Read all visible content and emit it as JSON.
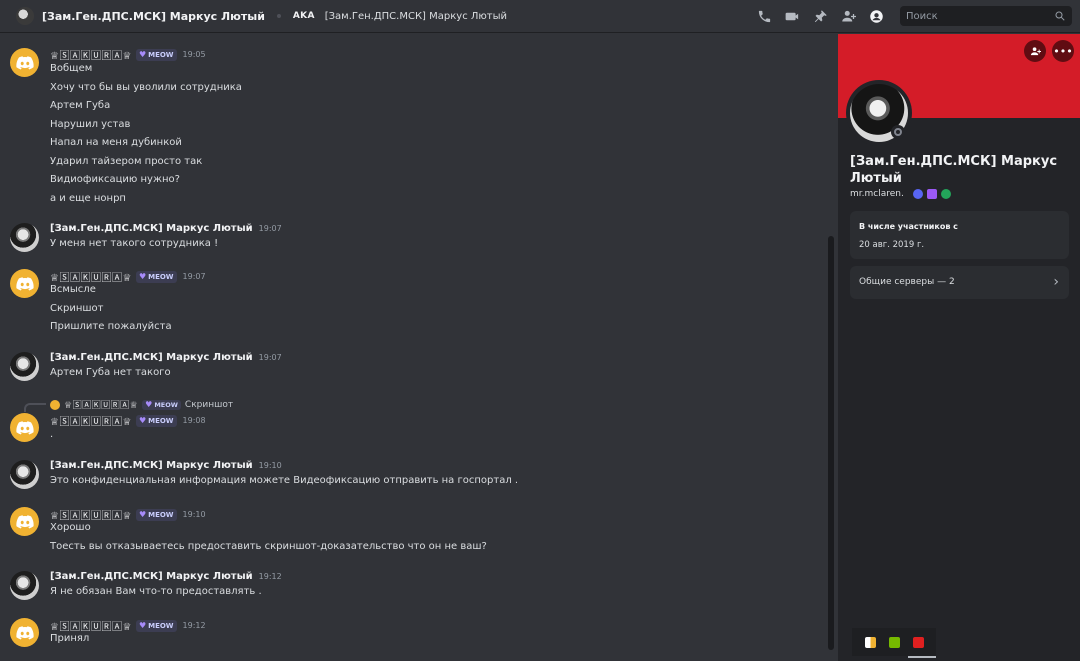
{
  "header": {
    "title": "[Зам.Ген.ДПС.МСК] Маркус Лютый",
    "aka_label": "AKA",
    "aka_name": "[Зам.Ген.ДПС.МСК] Маркус Лютый",
    "icons": [
      "phone-call-icon",
      "video-call-icon",
      "pin-icon",
      "add-friend-icon",
      "user-profile-icon"
    ],
    "search_placeholder": "Поиск"
  },
  "users": {
    "sakura_name": "♕🅂🄰🄺🅄🅁🄰♕",
    "sakura_tag": "MEOW",
    "marcus_name": "[Зам.Ген.ДПС.МСК] Маркус Лютый"
  },
  "messages": [
    {
      "author": "sakura",
      "time": "19:05",
      "lines": [
        "Вобщем",
        "Хочу что бы вы уволили сотрудника",
        "Артем Губа",
        "Нарушил устав",
        "Напал на меня дубинкой",
        "Ударил тайзером просто так",
        "Видиофиксацию нужно?",
        "а и еще нонрп"
      ]
    },
    {
      "author": "marcus",
      "time": "19:07",
      "lines": [
        "У меня нет такого сотрудника !"
      ]
    },
    {
      "author": "sakura",
      "time": "19:07",
      "lines": [
        "Всмысле",
        "Скриншот",
        "Пришлите пожалуйста"
      ]
    },
    {
      "author": "marcus",
      "time": "19:07",
      "lines": [
        "Артем Губа нет такого"
      ]
    },
    {
      "author": "sakura",
      "time": "19:08",
      "reply_text": "Скриншот",
      "lines": [
        "."
      ]
    },
    {
      "author": "marcus",
      "time": "19:10",
      "lines": [
        "Это конфиденциальная информация можете Видеофиксацию отправить на госпортал ."
      ]
    },
    {
      "author": "sakura",
      "time": "19:10",
      "lines": [
        "Хорошо",
        "Тоесть вы отказываетесь предоставить скриншот-доказательство что он не ваш?"
      ]
    },
    {
      "author": "marcus",
      "time": "19:12",
      "lines": [
        "Я не обязан Вам что-то предоставлять ."
      ]
    },
    {
      "author": "sakura",
      "time": "19:12",
      "lines": [
        "Принял"
      ]
    }
  ],
  "profile": {
    "banner_color": "#d41c28",
    "name": "[Зам.Ген.ДПС.МСК] Маркус Лютый",
    "username": "mr.mclaren.",
    "member_since_label": "В числе участников с",
    "member_since_value": "20 авг. 2019 г.",
    "mutual_servers_label": "Общие серверы — 2"
  },
  "colors": {
    "background": "#313338",
    "panel": "#232428",
    "accent_avatar": "#f0b232"
  }
}
